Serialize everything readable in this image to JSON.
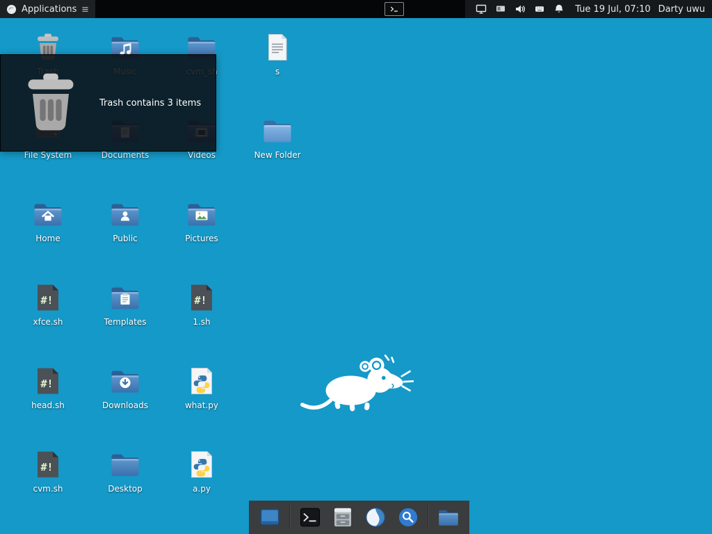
{
  "panel": {
    "applications_label": "Applications",
    "clock": "Tue 19 Jul, 07:10",
    "user": "Darty uwu",
    "tray": [
      "display",
      "workspaces",
      "volume",
      "keyboard",
      "notifications"
    ],
    "launcher": "terminal"
  },
  "tooltip": {
    "text": "Trash contains 3 items"
  },
  "desktop": {
    "background_color": "#1599c8",
    "icons": [
      {
        "label": "Trash",
        "type": "trash",
        "emblem": "",
        "col": 1,
        "row": 1
      },
      {
        "label": "Music",
        "type": "folder",
        "emblem": "music",
        "col": 2,
        "row": 1
      },
      {
        "label": "cvm_sh",
        "type": "folder",
        "emblem": "",
        "col": 3,
        "row": 1
      },
      {
        "label": "s",
        "type": "textfile",
        "emblem": "",
        "col": 4,
        "row": 1
      },
      {
        "label": "File System",
        "type": "drive",
        "emblem": "",
        "col": 1,
        "row": 2
      },
      {
        "label": "Documents",
        "type": "folder",
        "emblem": "documents",
        "col": 2,
        "row": 2
      },
      {
        "label": "Videos",
        "type": "folder",
        "emblem": "videos",
        "col": 3,
        "row": 2
      },
      {
        "label": "New Folder",
        "type": "folder-new",
        "emblem": "",
        "col": 4,
        "row": 2
      },
      {
        "label": "Home",
        "type": "folder",
        "emblem": "home",
        "col": 1,
        "row": 3
      },
      {
        "label": "Public",
        "type": "folder",
        "emblem": "public",
        "col": 2,
        "row": 3
      },
      {
        "label": "Pictures",
        "type": "folder",
        "emblem": "pictures",
        "col": 3,
        "row": 3
      },
      {
        "label": "xfce.sh",
        "type": "script",
        "emblem": "",
        "col": 1,
        "row": 4
      },
      {
        "label": "Templates",
        "type": "folder",
        "emblem": "templates",
        "col": 2,
        "row": 4
      },
      {
        "label": "1.sh",
        "type": "script",
        "emblem": "",
        "col": 3,
        "row": 4
      },
      {
        "label": "head.sh",
        "type": "script",
        "emblem": "",
        "col": 1,
        "row": 5
      },
      {
        "label": "Downloads",
        "type": "folder",
        "emblem": "downloads",
        "col": 2,
        "row": 5
      },
      {
        "label": "what.py",
        "type": "python",
        "emblem": "",
        "col": 3,
        "row": 5
      },
      {
        "label": "cvm.sh",
        "type": "script",
        "emblem": "",
        "col": 1,
        "row": 6
      },
      {
        "label": "Desktop",
        "type": "folder",
        "emblem": "",
        "col": 2,
        "row": 6
      },
      {
        "label": "a.py",
        "type": "python",
        "emblem": "",
        "col": 3,
        "row": 6
      }
    ]
  },
  "dock": {
    "items": [
      {
        "name": "show-desktop"
      },
      {
        "name": "separator"
      },
      {
        "name": "terminal"
      },
      {
        "name": "file-manager"
      },
      {
        "name": "browser"
      },
      {
        "name": "search"
      },
      {
        "name": "separator"
      },
      {
        "name": "file-folder"
      }
    ]
  },
  "colors": {
    "panel_bg": "#050607",
    "folder_blue": "#4a84c0",
    "dock_bg": "#3a3c3d"
  }
}
